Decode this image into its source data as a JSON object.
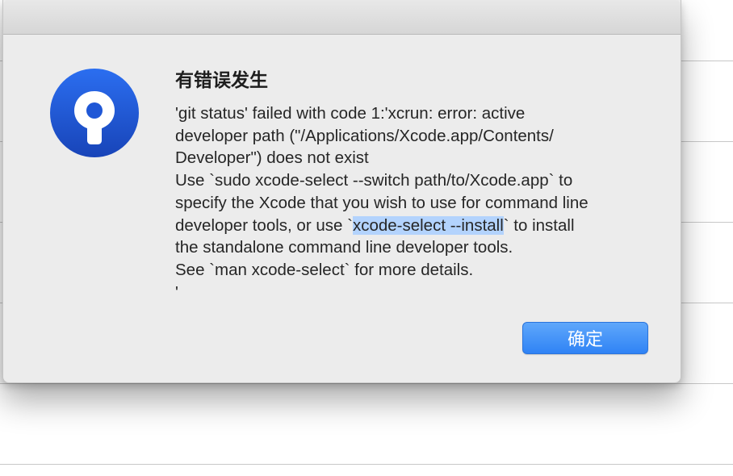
{
  "dialog": {
    "title": "有错误发生",
    "message_lines": [
      "'git status' failed with code 1:'xcrun: error: active",
      "developer path (\"/Applications/Xcode.app/Contents/",
      "Developer\") does not exist",
      "Use `sudo xcode-select --switch path/to/Xcode.app` to",
      "specify the Xcode that you wish to use for command line",
      {
        "before": "developer tools, or use `",
        "selected": "xcode-select --install",
        "after": "` to install"
      },
      "the standalone command line developer tools.",
      "See `man xcode-select` for more details.",
      "'"
    ],
    "ok_label": "确定"
  },
  "colors": {
    "accent": "#2f83f5",
    "icon_blue": "#1f57d6",
    "selection": "#b3d3fd",
    "dialog_bg": "#ececec"
  },
  "icons": {
    "app_icon": "sourcetree-app-icon"
  }
}
